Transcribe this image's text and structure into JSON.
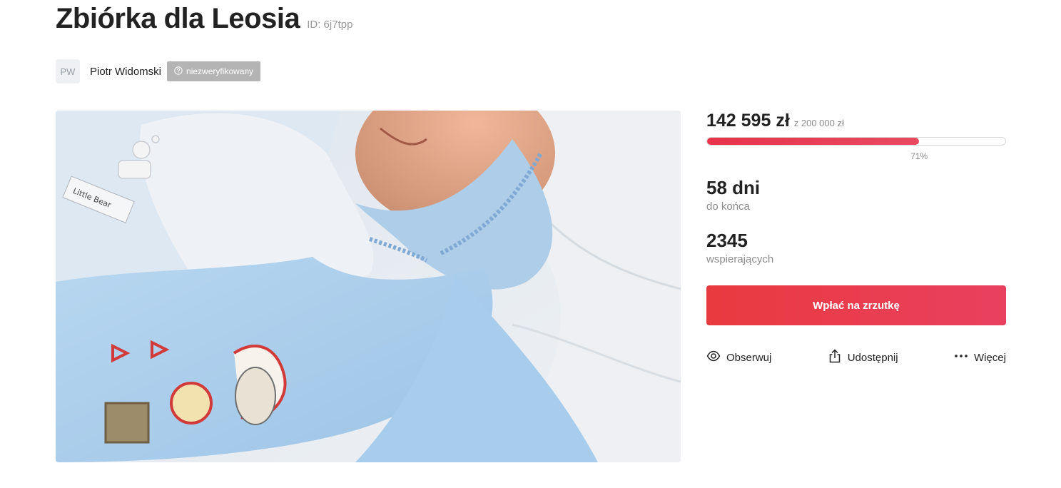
{
  "header": {
    "title": "Zbiórka dla Leosia",
    "fundraiser_id": "ID: 6j7tpp"
  },
  "organizer": {
    "initials": "PW",
    "name": "Piotr Widomski",
    "badge": "niezweryfikowany",
    "badge_icon": "question-circle-icon"
  },
  "photo": {
    "label_text": "Little Bear"
  },
  "funding": {
    "raised": "142 595 zł",
    "goal": "z 200 000 zł",
    "progress_percent": 71,
    "progress_label": "71%"
  },
  "stats": {
    "days_value": "58 dni",
    "days_label": "do końca",
    "supporters_value": "2345",
    "supporters_label": "wspierających"
  },
  "actions": {
    "donate_label": "Wpłać na zrzutkę",
    "follow_label": "Obserwuj",
    "follow_icon": "eye-icon",
    "share_label": "Udostępnij",
    "share_icon": "share-icon",
    "more_label": "Więcej",
    "more_icon": "more-dots-icon"
  },
  "colors": {
    "accent": "#e93a4c",
    "progress": "#e8334a",
    "badge_bg": "#b4b4b4"
  }
}
